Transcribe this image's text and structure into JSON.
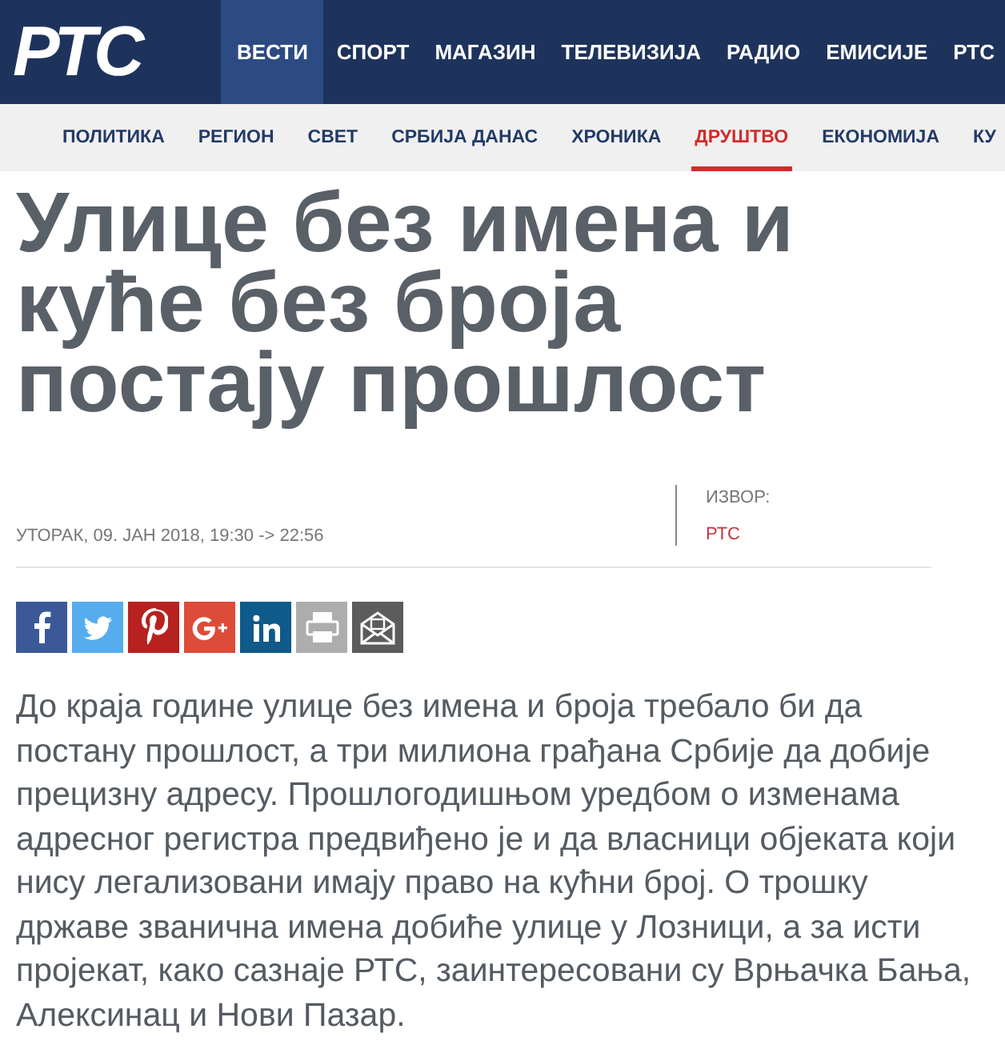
{
  "logo": "РТС",
  "main_nav": [
    {
      "label": "ВЕСТИ",
      "selected": true
    },
    {
      "label": "СПОРТ",
      "selected": false
    },
    {
      "label": "МАГАЗИН",
      "selected": false
    },
    {
      "label": "ТЕЛЕВИЗИЈА",
      "selected": false
    },
    {
      "label": "РАДИО",
      "selected": false
    },
    {
      "label": "ЕМИСИЈЕ",
      "selected": false
    },
    {
      "label": "РТС",
      "selected": false
    }
  ],
  "sub_nav": [
    {
      "label": "ПОЛИТИКА",
      "selected": false
    },
    {
      "label": "РЕГИОН",
      "selected": false
    },
    {
      "label": "СВЕТ",
      "selected": false
    },
    {
      "label": "СРБИЈА ДАНАС",
      "selected": false
    },
    {
      "label": "ХРОНИКА",
      "selected": false
    },
    {
      "label": "ДРУШТВО",
      "selected": true
    },
    {
      "label": "ЕКОНОМИЈА",
      "selected": false
    },
    {
      "label": "КУ",
      "selected": false
    }
  ],
  "article": {
    "title": "Улице без имена и куће без броја постају прошлост",
    "date": "УТОРАК, 09. ЈАН 2018, 19:30 -> 22:56",
    "source_label": "ИЗВОР:",
    "source": "РТС",
    "share": [
      {
        "kind": "facebook"
      },
      {
        "kind": "twitter"
      },
      {
        "kind": "pinterest"
      },
      {
        "kind": "googleplus"
      },
      {
        "kind": "linkedin"
      },
      {
        "kind": "print"
      },
      {
        "kind": "email"
      }
    ],
    "body": "До краја године улице без имена и броја требало би да постану прошлост, а три милиона грађана Србије да добије прецизну адресу. Прошлогодишњом уредбом о изменама адресног регистра предвиђено је и да власници објеката који нису легализовани имају право на кућни број. О трошку државе званична имена добиће улице у Лозници, а за исти пројекат, како сазнаје РТС, заинтересовани су Врњачка Бања, Алексинац и Нови Пазар."
  }
}
